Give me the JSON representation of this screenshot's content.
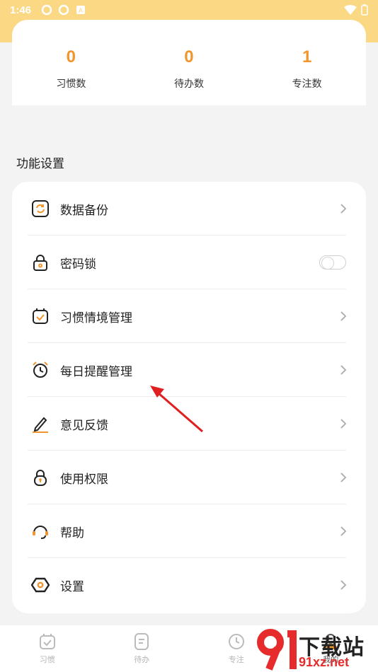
{
  "status_bar": {
    "time": "1:46"
  },
  "stats": [
    {
      "value": "0",
      "label": "习惯数"
    },
    {
      "value": "0",
      "label": "待办数"
    },
    {
      "value": "1",
      "label": "专注数"
    }
  ],
  "section_title": "功能设置",
  "settings": [
    {
      "label": "数据备份",
      "icon": "backup-icon",
      "control": "chevron"
    },
    {
      "label": "密码锁",
      "icon": "lock-icon",
      "control": "toggle",
      "toggle_on": false
    },
    {
      "label": "习惯情境管理",
      "icon": "calendar-check-icon",
      "control": "chevron"
    },
    {
      "label": "每日提醒管理",
      "icon": "alarm-clock-icon",
      "control": "chevron"
    },
    {
      "label": "意见反馈",
      "icon": "pen-icon",
      "control": "chevron"
    },
    {
      "label": "使用权限",
      "icon": "permission-lock-icon",
      "control": "chevron"
    },
    {
      "label": "帮助",
      "icon": "headset-icon",
      "control": "chevron"
    },
    {
      "label": "设置",
      "icon": "hexagon-gear-icon",
      "control": "chevron"
    }
  ],
  "bottom_nav": [
    {
      "label": "习惯",
      "icon": "habit-icon"
    },
    {
      "label": "待办",
      "icon": "todo-icon"
    },
    {
      "label": "专注",
      "icon": "clock-icon"
    },
    {
      "label": "我的",
      "icon": "profile-icon"
    }
  ],
  "watermark": {
    "title": "下载站",
    "domain": "91xz.net"
  },
  "colors": {
    "header": "#fad884",
    "accent": "#f0962e",
    "annotation": "#e02020"
  }
}
